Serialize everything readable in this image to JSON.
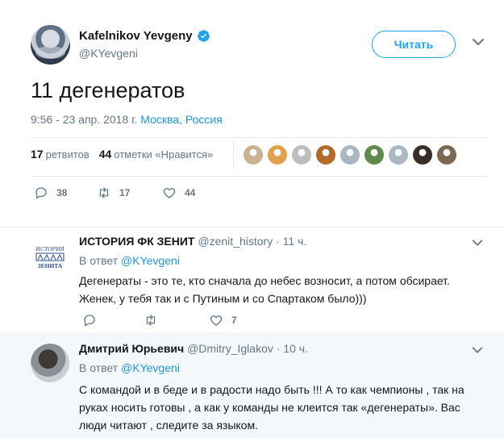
{
  "main_tweet": {
    "author_name": "Kafelnikov Yevgeny",
    "author_handle": "@KYevgeni",
    "follow_label": "Читать",
    "text": "11 дегенератов",
    "time_date": "9:56 - 23 апр. 2018 г.",
    "location": "Москва, Россия",
    "retweets_count": "17",
    "retweets_label": "ретвитов",
    "likes_count": "44",
    "likes_label": "отметки «Нравится»",
    "actions": {
      "reply_count": "38",
      "retweet_count": "17",
      "like_count": "44"
    },
    "likers": [
      "#c9b48f",
      "#e1a04b",
      "#bdbdbd",
      "#b46a2a",
      "#aab8c2",
      "#5f8a4c",
      "#aab8c2",
      "#3b2f2a",
      "#7a6a55"
    ]
  },
  "replies": [
    {
      "author_name": "ИСТОРИЯ ФК ЗЕНИТ",
      "author_handle": "@zenit_history",
      "time": "· 11 ч.",
      "reply_to_prefix": "В ответ",
      "reply_to_handle": "@KYevgeni",
      "avatar_text_top": "ИСТОРИЯ",
      "avatar_text_bottom": "ЗЕНИТА",
      "text": "Дегенераты - это те, кто сначала до небес возносит, а потом обсирает. Женек, у тебя так и с Путиным и со Спартаком было)))",
      "like_count": "7"
    },
    {
      "author_name": "Дмитрий Юрьевич",
      "author_handle": "@Dmitry_Iglakov",
      "time": "· 10 ч.",
      "reply_to_prefix": "В ответ",
      "reply_to_handle": "@KYevgeni",
      "text": "С командой и в беде и в радости надо быть !!! А то как чемпионы , так на руках носить готовы , а как у команды не клеится так «дегенераты». Вас люди читают , следите за языком."
    }
  ],
  "colors": {
    "accent": "#1da1f2",
    "link": "#1b95e0",
    "muted": "#657786",
    "divider": "#e6ecf0",
    "reply_bg": "#f5f8fa"
  }
}
